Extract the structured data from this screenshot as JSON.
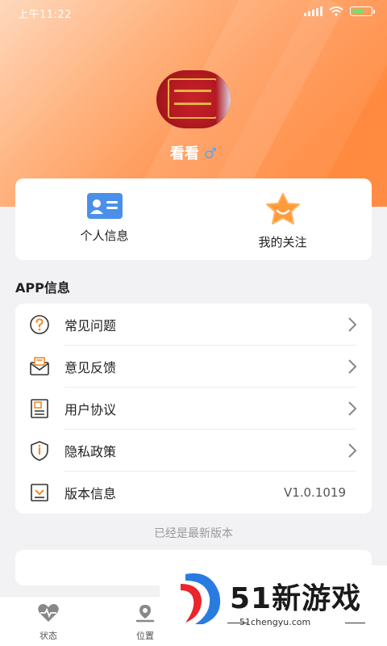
{
  "status_bar": {
    "time": "上午11:22"
  },
  "profile": {
    "name": "看看",
    "gender_symbol": "♂"
  },
  "quick_actions": [
    {
      "label": "个人信息",
      "icon": "id-card-icon"
    },
    {
      "label": "我的关注",
      "icon": "star-smile-icon"
    }
  ],
  "app_section": {
    "title": "APP信息"
  },
  "menu": [
    {
      "label": "常见问题",
      "icon": "question-icon"
    },
    {
      "label": "意见反馈",
      "icon": "mail-icon"
    },
    {
      "label": "用户协议",
      "icon": "document-icon"
    },
    {
      "label": "隐私政策",
      "icon": "shield-icon"
    },
    {
      "label": "版本信息",
      "icon": "download-icon",
      "value": "V1.0.1019"
    }
  ],
  "version_hint": "已经是最新版本",
  "tabbar": [
    {
      "label": "状态",
      "icon": "heart-pulse-icon"
    },
    {
      "label": "位置",
      "icon": "location-icon"
    }
  ],
  "watermark": {
    "title": "51新游戏",
    "site": "51chengyu.com"
  },
  "colors": {
    "accent": "#ff8a3f",
    "icon_orange": "#f08a2c",
    "quick_blue": "#4a90e8",
    "star_orange": "#ff9a3a"
  }
}
